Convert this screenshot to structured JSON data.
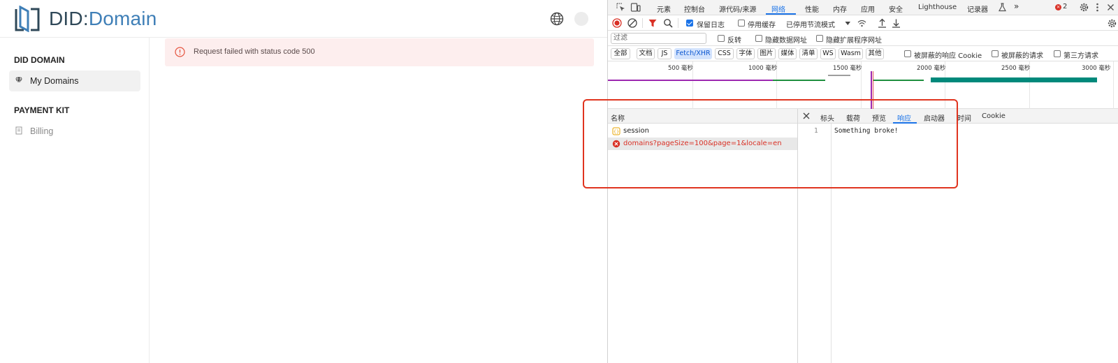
{
  "app": {
    "brand": {
      "part1": "DID",
      "separator": ":",
      "part2": "Domain"
    },
    "icons": {
      "logo": "did-logo",
      "globe": "globe-icon",
      "avatar": "avatar"
    },
    "sidebar": {
      "sections": [
        {
          "title": "DID DOMAIN",
          "items": [
            {
              "label": "My Domains",
              "icon": "gem-icon",
              "active": true
            }
          ]
        },
        {
          "title": "PAYMENT KIT",
          "items": [
            {
              "label": "Billing",
              "icon": "billing-icon",
              "active": false
            }
          ]
        }
      ]
    },
    "alert": {
      "icon": "error-circle-icon",
      "message": "Request failed with status code 500",
      "color": "#fdeeee"
    }
  },
  "devtools": {
    "tabs": [
      "元素",
      "控制台",
      "源代码/来源",
      "网络",
      "性能",
      "内存",
      "应用",
      "安全",
      "Lighthouse",
      "记录器"
    ],
    "active_tab": "网络",
    "more_tabs": "»",
    "error_count": "2",
    "toolbar": {
      "preserve_log": "保留日志",
      "disable_cache": "停用缓存",
      "throttling": "已停用节流模式"
    },
    "filter": {
      "placeholder": "过滤",
      "invert": "反转",
      "hide_data_urls": "隐藏数据网址",
      "hide_extension_urls": "隐藏扩展程序网址"
    },
    "types": [
      "全部",
      "文档",
      "JS",
      "Fetch/XHR",
      "CSS",
      "字体",
      "图片",
      "媒体",
      "清单",
      "WS",
      "Wasm",
      "其他"
    ],
    "active_type": "Fetch/XHR",
    "type_row_checks": [
      "被屏蔽的响应 Cookie",
      "被屏蔽的请求",
      "第三方请求"
    ],
    "timeline": {
      "ticks": [
        "500 毫秒",
        "1000 毫秒",
        "1500 毫秒",
        "2000 毫秒",
        "2500 毫秒",
        "3000 毫秒"
      ],
      "colors": {
        "purple": "#9c27b0",
        "green": "#1e8e3e",
        "teal": "#00897b",
        "gray": "#9e9e9e"
      }
    },
    "requests": {
      "column_name": "名称",
      "rows": [
        {
          "name": "session",
          "icon": "xhr-icon",
          "error": false
        },
        {
          "name": "domains?pageSize=100&page=1&locale=en",
          "icon": "error-icon",
          "error": true
        }
      ]
    },
    "detail": {
      "tabs": [
        "标头",
        "载荷",
        "预览",
        "响应",
        "启动器",
        "时间",
        "Cookie"
      ],
      "active_tab": "响应",
      "line_number": "1",
      "response_body": "Something broke!"
    },
    "highlight_color": "#e0341f"
  }
}
